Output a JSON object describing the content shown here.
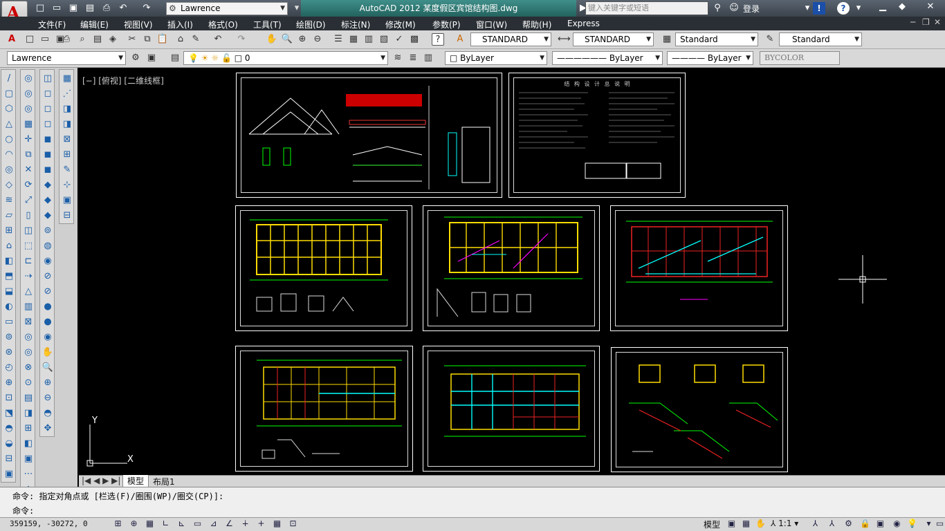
{
  "titlebar": {
    "app_title": "AutoCAD 2012    某度假区宾馆结构图.dwg",
    "workspace": "Lawrence",
    "search_placeholder": "键入关键字或短语",
    "login": "登录"
  },
  "menu": [
    "文件(F)",
    "编辑(E)",
    "视图(V)",
    "插入(I)",
    "格式(O)",
    "工具(T)",
    "绘图(D)",
    "标注(N)",
    "修改(M)",
    "参数(P)",
    "窗口(W)",
    "帮助(H)",
    "Express"
  ],
  "styles": {
    "text_style": "STANDARD",
    "dim_style": "STANDARD",
    "table_style": "Standard",
    "multileader_style": "Standard"
  },
  "layers": {
    "workspace_combo": "Lawrence",
    "layer_current": "0",
    "color": "ByLayer",
    "linetype": "ByLayer",
    "lineweight": "ByLayer",
    "plotstyle": "BYCOLOR"
  },
  "viewport": {
    "label": "[−] [俯视] [二维线框]"
  },
  "ucs": {
    "x": "X",
    "y": "Y"
  },
  "tabs": {
    "model": "模型",
    "layout1": "布局1"
  },
  "command": {
    "history": "命令: 指定对角点或 [栏选(F)/圈围(WP)/圈交(CP)]:",
    "prompt": "命令:"
  },
  "status": {
    "coords": "359159, -30272, 0",
    "model": "模型",
    "scale": "1:1"
  },
  "drawing_title_text": "结 构 设 计 总 说 明",
  "colors": {
    "titlebar_tab": "#2f7a75",
    "canvas": "#000000",
    "menubar": "#2a2f35"
  }
}
